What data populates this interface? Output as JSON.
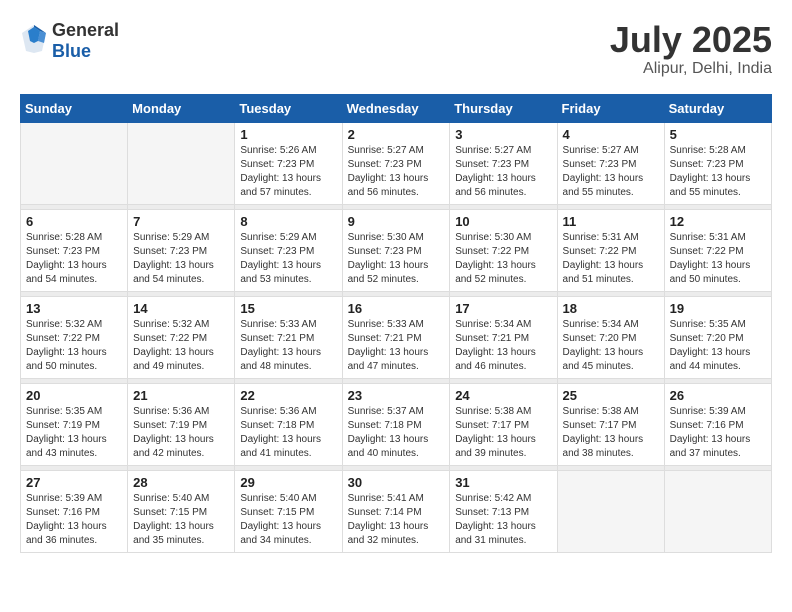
{
  "header": {
    "logo_general": "General",
    "logo_blue": "Blue",
    "month": "July 2025",
    "location": "Alipur, Delhi, India"
  },
  "weekdays": [
    "Sunday",
    "Monday",
    "Tuesday",
    "Wednesday",
    "Thursday",
    "Friday",
    "Saturday"
  ],
  "weeks": [
    [
      {
        "day": "",
        "empty": true
      },
      {
        "day": "",
        "empty": true
      },
      {
        "day": "1",
        "sunrise": "Sunrise: 5:26 AM",
        "sunset": "Sunset: 7:23 PM",
        "daylight": "Daylight: 13 hours and 57 minutes."
      },
      {
        "day": "2",
        "sunrise": "Sunrise: 5:27 AM",
        "sunset": "Sunset: 7:23 PM",
        "daylight": "Daylight: 13 hours and 56 minutes."
      },
      {
        "day": "3",
        "sunrise": "Sunrise: 5:27 AM",
        "sunset": "Sunset: 7:23 PM",
        "daylight": "Daylight: 13 hours and 56 minutes."
      },
      {
        "day": "4",
        "sunrise": "Sunrise: 5:27 AM",
        "sunset": "Sunset: 7:23 PM",
        "daylight": "Daylight: 13 hours and 55 minutes."
      },
      {
        "day": "5",
        "sunrise": "Sunrise: 5:28 AM",
        "sunset": "Sunset: 7:23 PM",
        "daylight": "Daylight: 13 hours and 55 minutes."
      }
    ],
    [
      {
        "day": "6",
        "sunrise": "Sunrise: 5:28 AM",
        "sunset": "Sunset: 7:23 PM",
        "daylight": "Daylight: 13 hours and 54 minutes."
      },
      {
        "day": "7",
        "sunrise": "Sunrise: 5:29 AM",
        "sunset": "Sunset: 7:23 PM",
        "daylight": "Daylight: 13 hours and 54 minutes."
      },
      {
        "day": "8",
        "sunrise": "Sunrise: 5:29 AM",
        "sunset": "Sunset: 7:23 PM",
        "daylight": "Daylight: 13 hours and 53 minutes."
      },
      {
        "day": "9",
        "sunrise": "Sunrise: 5:30 AM",
        "sunset": "Sunset: 7:23 PM",
        "daylight": "Daylight: 13 hours and 52 minutes."
      },
      {
        "day": "10",
        "sunrise": "Sunrise: 5:30 AM",
        "sunset": "Sunset: 7:22 PM",
        "daylight": "Daylight: 13 hours and 52 minutes."
      },
      {
        "day": "11",
        "sunrise": "Sunrise: 5:31 AM",
        "sunset": "Sunset: 7:22 PM",
        "daylight": "Daylight: 13 hours and 51 minutes."
      },
      {
        "day": "12",
        "sunrise": "Sunrise: 5:31 AM",
        "sunset": "Sunset: 7:22 PM",
        "daylight": "Daylight: 13 hours and 50 minutes."
      }
    ],
    [
      {
        "day": "13",
        "sunrise": "Sunrise: 5:32 AM",
        "sunset": "Sunset: 7:22 PM",
        "daylight": "Daylight: 13 hours and 50 minutes."
      },
      {
        "day": "14",
        "sunrise": "Sunrise: 5:32 AM",
        "sunset": "Sunset: 7:22 PM",
        "daylight": "Daylight: 13 hours and 49 minutes."
      },
      {
        "day": "15",
        "sunrise": "Sunrise: 5:33 AM",
        "sunset": "Sunset: 7:21 PM",
        "daylight": "Daylight: 13 hours and 48 minutes."
      },
      {
        "day": "16",
        "sunrise": "Sunrise: 5:33 AM",
        "sunset": "Sunset: 7:21 PM",
        "daylight": "Daylight: 13 hours and 47 minutes."
      },
      {
        "day": "17",
        "sunrise": "Sunrise: 5:34 AM",
        "sunset": "Sunset: 7:21 PM",
        "daylight": "Daylight: 13 hours and 46 minutes."
      },
      {
        "day": "18",
        "sunrise": "Sunrise: 5:34 AM",
        "sunset": "Sunset: 7:20 PM",
        "daylight": "Daylight: 13 hours and 45 minutes."
      },
      {
        "day": "19",
        "sunrise": "Sunrise: 5:35 AM",
        "sunset": "Sunset: 7:20 PM",
        "daylight": "Daylight: 13 hours and 44 minutes."
      }
    ],
    [
      {
        "day": "20",
        "sunrise": "Sunrise: 5:35 AM",
        "sunset": "Sunset: 7:19 PM",
        "daylight": "Daylight: 13 hours and 43 minutes."
      },
      {
        "day": "21",
        "sunrise": "Sunrise: 5:36 AM",
        "sunset": "Sunset: 7:19 PM",
        "daylight": "Daylight: 13 hours and 42 minutes."
      },
      {
        "day": "22",
        "sunrise": "Sunrise: 5:36 AM",
        "sunset": "Sunset: 7:18 PM",
        "daylight": "Daylight: 13 hours and 41 minutes."
      },
      {
        "day": "23",
        "sunrise": "Sunrise: 5:37 AM",
        "sunset": "Sunset: 7:18 PM",
        "daylight": "Daylight: 13 hours and 40 minutes."
      },
      {
        "day": "24",
        "sunrise": "Sunrise: 5:38 AM",
        "sunset": "Sunset: 7:17 PM",
        "daylight": "Daylight: 13 hours and 39 minutes."
      },
      {
        "day": "25",
        "sunrise": "Sunrise: 5:38 AM",
        "sunset": "Sunset: 7:17 PM",
        "daylight": "Daylight: 13 hours and 38 minutes."
      },
      {
        "day": "26",
        "sunrise": "Sunrise: 5:39 AM",
        "sunset": "Sunset: 7:16 PM",
        "daylight": "Daylight: 13 hours and 37 minutes."
      }
    ],
    [
      {
        "day": "27",
        "sunrise": "Sunrise: 5:39 AM",
        "sunset": "Sunset: 7:16 PM",
        "daylight": "Daylight: 13 hours and 36 minutes."
      },
      {
        "day": "28",
        "sunrise": "Sunrise: 5:40 AM",
        "sunset": "Sunset: 7:15 PM",
        "daylight": "Daylight: 13 hours and 35 minutes."
      },
      {
        "day": "29",
        "sunrise": "Sunrise: 5:40 AM",
        "sunset": "Sunset: 7:15 PM",
        "daylight": "Daylight: 13 hours and 34 minutes."
      },
      {
        "day": "30",
        "sunrise": "Sunrise: 5:41 AM",
        "sunset": "Sunset: 7:14 PM",
        "daylight": "Daylight: 13 hours and 32 minutes."
      },
      {
        "day": "31",
        "sunrise": "Sunrise: 5:42 AM",
        "sunset": "Sunset: 7:13 PM",
        "daylight": "Daylight: 13 hours and 31 minutes."
      },
      {
        "day": "",
        "empty": true
      },
      {
        "day": "",
        "empty": true
      }
    ]
  ]
}
